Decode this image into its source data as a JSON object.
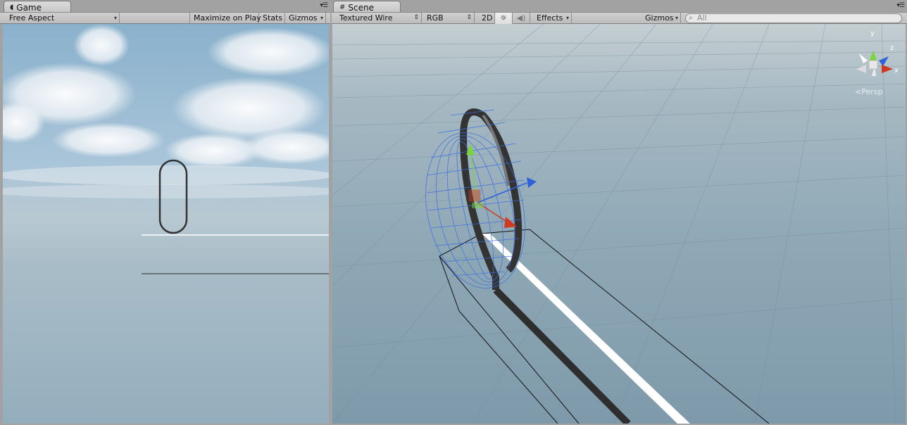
{
  "game": {
    "tab_label": "Game",
    "aspect_label": "Free Aspect",
    "maximize_label": "Maximize on Play",
    "stats_label": "Stats",
    "gizmos_label": "Gizmos"
  },
  "scene": {
    "tab_label": "Scene",
    "draw_mode_label": "Textured Wire",
    "render_mode_label": "RGB",
    "mode_2d_label": "2D",
    "effects_label": "Effects",
    "gizmos_label": "Gizmos",
    "search_text": "All",
    "axis_y": "y",
    "axis_z": "z",
    "axis_x": "x",
    "projection_label": "Persp"
  },
  "colors": {
    "x_axis": "#d03a1f",
    "y_axis": "#7ad43a",
    "z_axis": "#2f62d8",
    "wireframe": "#3d6fe0"
  },
  "icons": {
    "game_tab": "pacman-icon",
    "scene_tab": "grid-icon",
    "lighting": "sun-icon",
    "audio": "speaker-icon",
    "search": "magnifier-icon",
    "panel_menu": "menu-icon"
  }
}
